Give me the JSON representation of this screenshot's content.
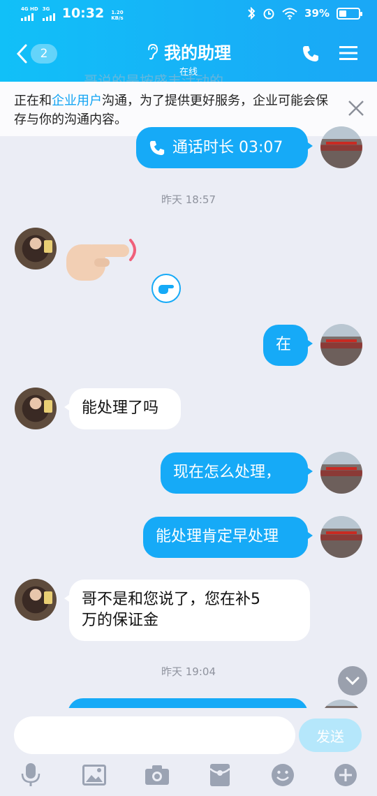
{
  "status_bar": {
    "net1": "4G HD",
    "net2": "3G",
    "time": "10:32",
    "speed_value": "1.20",
    "speed_unit": "KB/s",
    "battery": "39%",
    "battery_level": 0.39
  },
  "header": {
    "back_count": "2",
    "title": "我的助理",
    "subtitle": "在线"
  },
  "notice": {
    "prefix": "正在和",
    "link": "企业用户",
    "suffix": "沟通，为了提供更好服务，企业可能会保存与你的沟通内容。"
  },
  "ghost_text": "哥说的是按盛丰活动的",
  "messages": {
    "call": {
      "label": "通话时长 03:07"
    },
    "time1": "昨天 18:57",
    "m_out_1": "在",
    "m_in_1": "能处理了吗",
    "m_out_2": "现在怎么处理，",
    "m_out_3": "能处理肯定早处理",
    "m_in_2_line1": "哥不是和您说了，您在补5",
    "m_in_2_line2": "万的保证金",
    "time2": "昨天 19:04"
  },
  "input": {
    "placeholder": "",
    "send_label": "发送"
  },
  "toolbar": {
    "icons": [
      "microphone-icon",
      "image-icon",
      "camera-icon",
      "red-packet-icon",
      "emoji-icon",
      "plus-icon"
    ]
  },
  "colors": {
    "accent": "#16aaf7",
    "header_start": "#11c0f8",
    "header_end": "#1aa7f6",
    "background": "#ebedf5"
  }
}
